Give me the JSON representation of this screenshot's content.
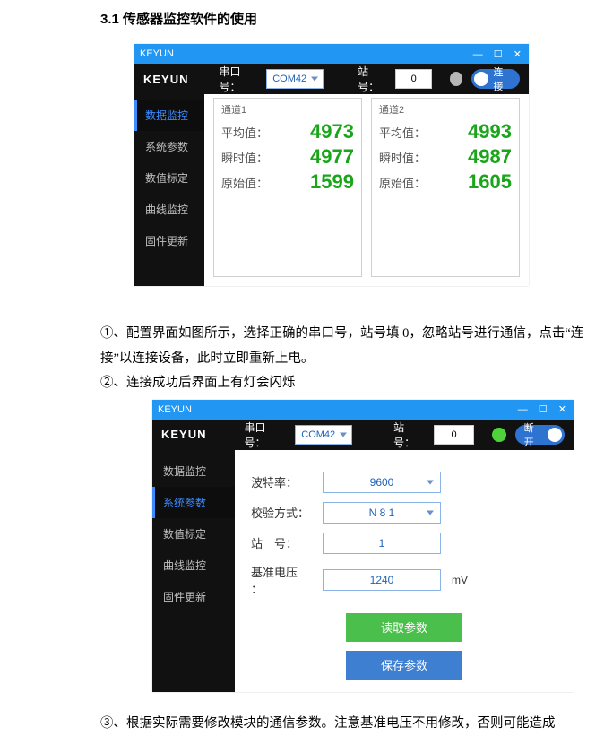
{
  "section_title": "3.1 传感器监控软件的使用",
  "fig1": {
    "window_title": "KEYUN",
    "logo": "KEYUN",
    "port_label": "串口号：",
    "port_value": "COM42",
    "station_label": "站号：",
    "station_value": "0",
    "connect_label": "连接",
    "sidebar": [
      "数据监控",
      "系统参数",
      "数值标定",
      "曲线监控",
      "固件更新"
    ],
    "active_sidebar_index": 0,
    "channels": [
      {
        "title": "通道1",
        "rows": [
          {
            "k": "平均值：",
            "v": "4973"
          },
          {
            "k": "瞬时值：",
            "v": "4977"
          },
          {
            "k": "原始值：",
            "v": "1599"
          }
        ]
      },
      {
        "title": "通道2",
        "rows": [
          {
            "k": "平均值：",
            "v": "4993"
          },
          {
            "k": "瞬时值：",
            "v": "4987"
          },
          {
            "k": "原始值：",
            "v": "1605"
          }
        ]
      }
    ]
  },
  "para1": "①、配置界面如图所示，选择正确的串口号，站号填 0，忽略站号进行通信，点击“连接”以连接设备，此时立即重新上电。",
  "para2": "②、连接成功后界面上有灯会闪烁",
  "fig2": {
    "window_title": "KEYUN",
    "logo": "KEYUN",
    "port_label": "串口号：",
    "port_value": "COM42",
    "station_label": "站号：",
    "station_value": "0",
    "disconnect_label": "断开",
    "sidebar": [
      "数据监控",
      "系统参数",
      "数值标定",
      "曲线监控",
      "固件更新"
    ],
    "active_sidebar_index": 1,
    "params": {
      "baud_label": "波特率：",
      "baud_value": "9600",
      "parity_label": "校验方式：",
      "parity_value": "N 8 1",
      "station_label": "站　号：",
      "station_value": "1",
      "vref_label": "基准电压 ：",
      "vref_value": "1240",
      "vref_unit": "mV",
      "read_btn": "读取参数",
      "save_btn": "保存参数"
    }
  },
  "para3": "③、根据实际需要修改模块的通信参数。注意基准电压不用修改，否则可能造成"
}
